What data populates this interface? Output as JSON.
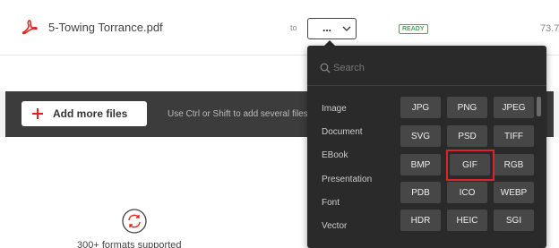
{
  "file": {
    "name": "5-Towing Torrance.pdf",
    "to_label": "to",
    "format_value": "...",
    "status": "READY",
    "size": "73.7"
  },
  "toolbar": {
    "add_files_label": "Add more files",
    "hint": "Use Ctrl or Shift to add several files at once"
  },
  "dropdown": {
    "search_placeholder": "Search",
    "categories": [
      "Image",
      "Document",
      "EBook",
      "Presentation",
      "Font",
      "Vector"
    ],
    "formats": [
      "JPG",
      "PNG",
      "JPEG",
      "SVG",
      "PSD",
      "TIFF",
      "BMP",
      "GIF",
      "RGB",
      "PDB",
      "ICO",
      "WEBP",
      "HDR",
      "HEIC",
      "SGI"
    ],
    "highlighted": "GIF"
  },
  "footer": {
    "formats_text": "300+ formats supported"
  },
  "colors": {
    "pdf_red": "#e2231a",
    "add_plus_red": "#e2231a",
    "ready_green": "#3cb05b",
    "highlight_red": "#e0232a",
    "dropdown_bg": "#2a2a2a",
    "format_btn_bg": "#474747"
  },
  "icons": {
    "file_type": "pdf-icon",
    "select_chevron": "chevron-down-icon",
    "add": "plus-icon",
    "search": "search-icon",
    "formats": "refresh-icon"
  }
}
